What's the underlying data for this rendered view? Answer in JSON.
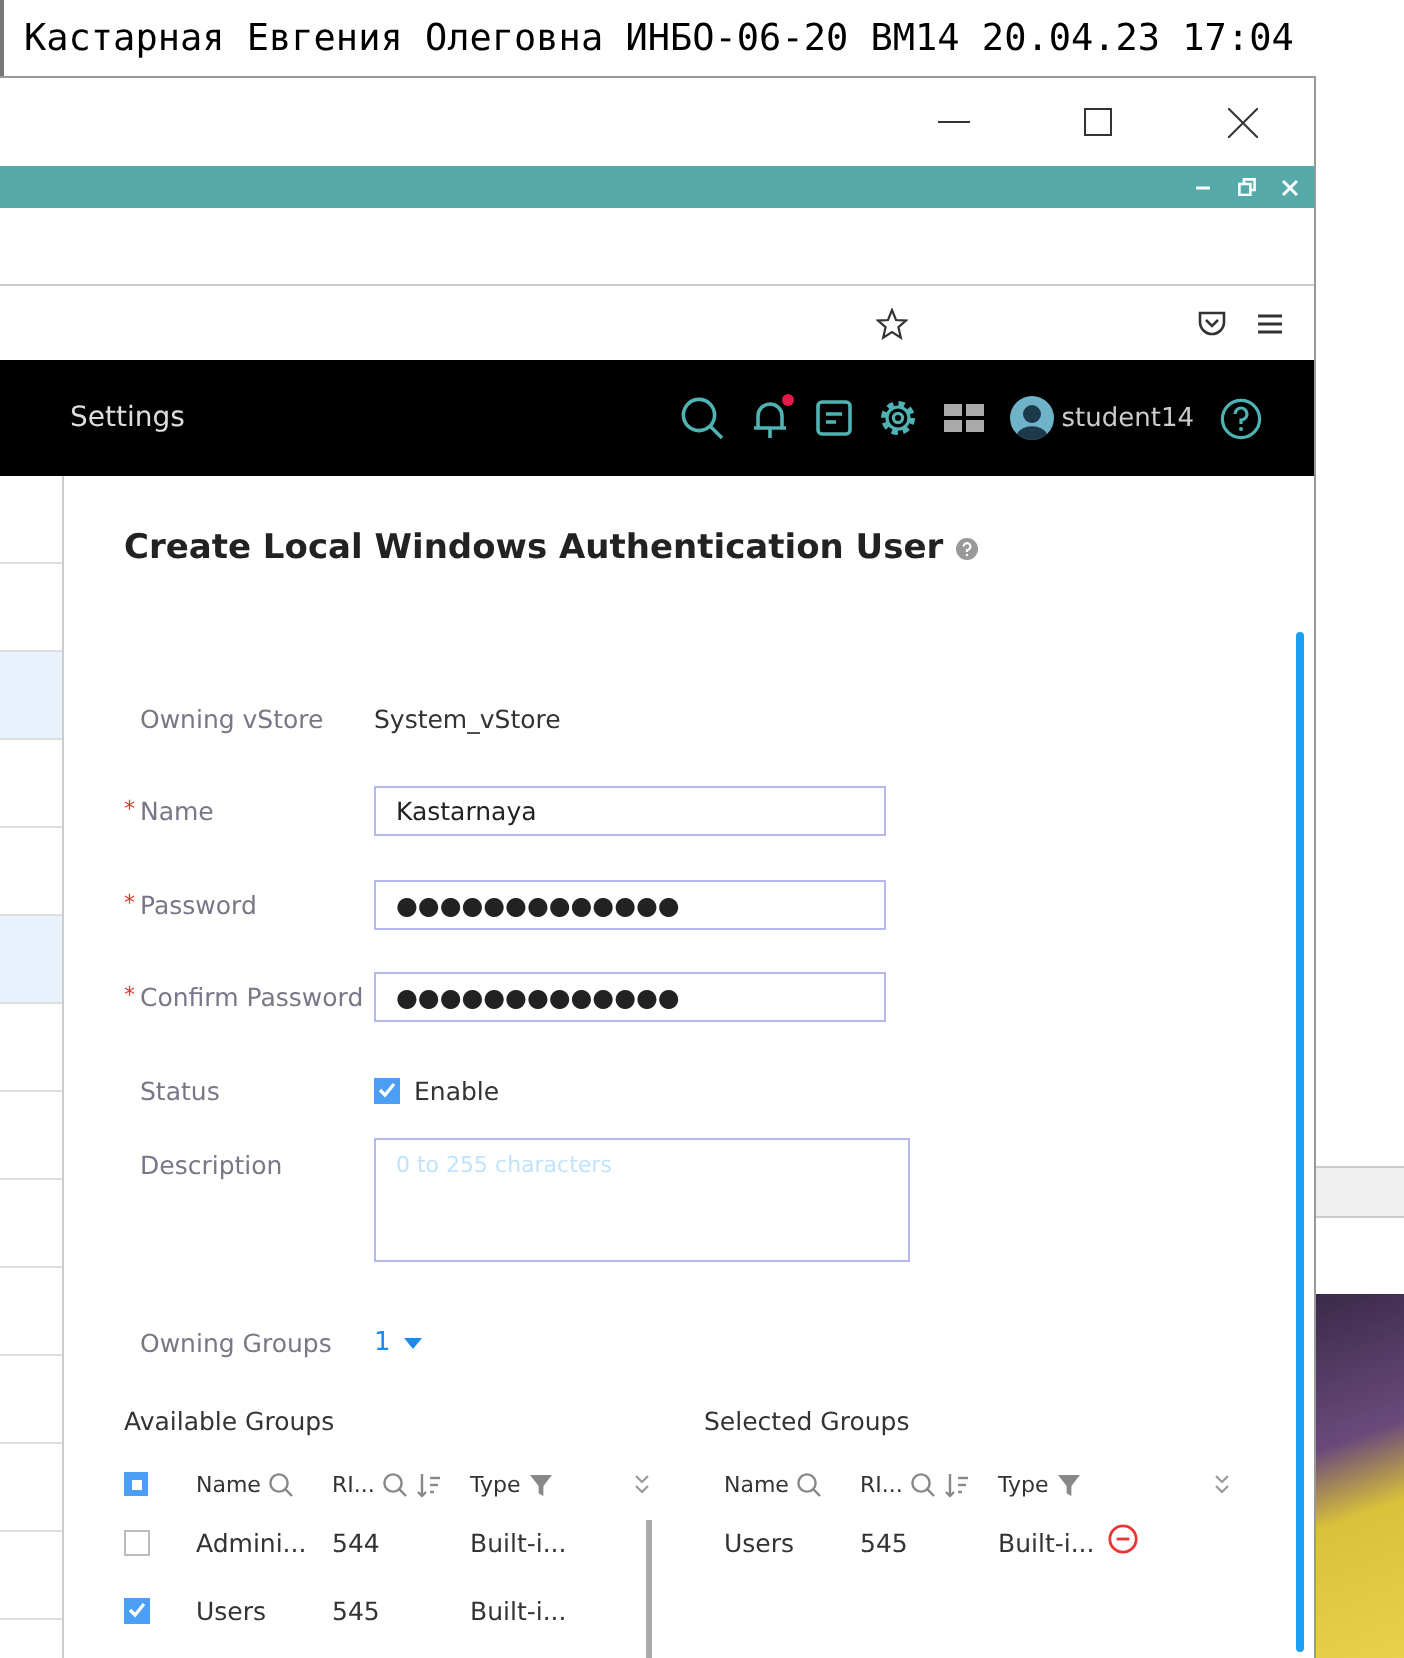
{
  "caption": "Кастарная Евгения Олеговна ИНБО-06-20 ВМ14 20.04.23 17:04",
  "app_header": {
    "title": "Settings",
    "user": "student14",
    "notification": true
  },
  "dialog": {
    "title": "Create Local Windows Authentication User",
    "fields": [
      {
        "kind": "text",
        "label": "Owning vStore",
        "value": "System_vStore"
      },
      {
        "kind": "input",
        "label": "Name",
        "value": "Kastarnaya",
        "required_mark": "*"
      },
      {
        "kind": "input",
        "label": "Password",
        "value": "●●●●●●●●●●●●●",
        "required_mark": "*"
      },
      {
        "kind": "input",
        "label": "Confirm Password",
        "value": "●●●●●●●●●●●●●",
        "required_mark": "*"
      },
      {
        "kind": "checkbox",
        "label": "Status",
        "value": "Enable",
        "checked": true
      },
      {
        "kind": "textarea",
        "label": "Description",
        "placeholder": "0 to 255 characters"
      },
      {
        "kind": "dropdown",
        "label": "Owning Groups",
        "value": "1"
      }
    ],
    "available_groups": {
      "title": "Available Groups",
      "indeterminate": true,
      "columns": [
        "Name",
        "RI...",
        "Type"
      ],
      "rows": [
        {
          "cells": [
            "Admini...",
            "544",
            "Built-i..."
          ],
          "checked": false
        },
        {
          "cells": [
            "Users",
            "545",
            "Built-i..."
          ],
          "checked": true
        }
      ]
    },
    "selected_groups": {
      "title": "Selected Groups",
      "columns": [
        "Name",
        "RI...",
        "Type"
      ],
      "rows": [
        {
          "cells": [
            "Users",
            "545",
            "Built-i..."
          ]
        }
      ]
    }
  }
}
